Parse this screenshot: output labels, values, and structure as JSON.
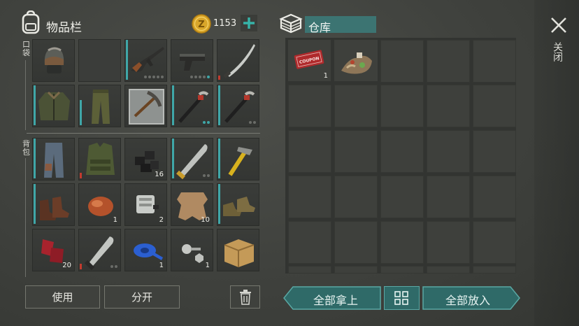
{
  "inventory": {
    "title": "物品栏",
    "coins": "1153",
    "pockets_label": "口袋",
    "backpack_label": "背包",
    "items": {
      "melee_pocket_qty": "",
      "coal_qty": "16",
      "resin_qty": "1",
      "engine_qty": "2",
      "hide_qty": "10",
      "cloth_qty": "20",
      "tape_qty": "1",
      "bolts_qty": "1"
    }
  },
  "storage": {
    "title": "仓库",
    "coupon_text": "COMBAT GEAR COUPON",
    "coupon_qty": "1"
  },
  "close_label": "关闭",
  "buttons": {
    "use": "使用",
    "split": "分开",
    "take_all": "全部拿上",
    "put_all": "全部放入"
  },
  "colors": {
    "accent_teal": "#3fa7a8",
    "damage_red": "#c23b2e",
    "coin_gold": "#d9a62a"
  }
}
